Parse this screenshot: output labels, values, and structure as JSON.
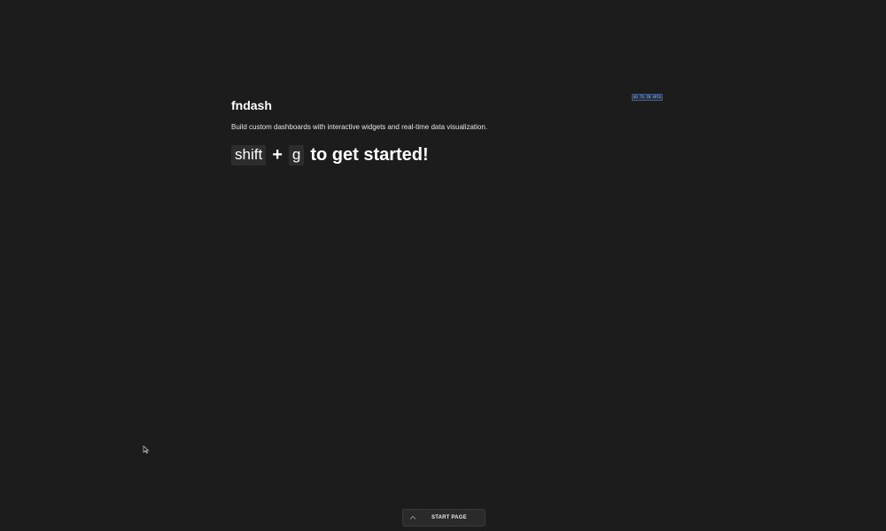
{
  "app": {
    "title": "fndash",
    "description": "Build custom dashboards with interactive widgets and real-time data visualization."
  },
  "get_started": {
    "key1": "shift",
    "plus": "+",
    "key2": "g",
    "text": "to get started!"
  },
  "badge": {
    "text": "GO TO IN APIS"
  },
  "bottom_bar": {
    "label": "START PAGE",
    "icon": "chevron-up-icon"
  },
  "colors": {
    "background": "#1c1c1c",
    "key_background": "#2d2d2d",
    "badge_background": "#24324a",
    "badge_border": "#3e5a8a"
  }
}
